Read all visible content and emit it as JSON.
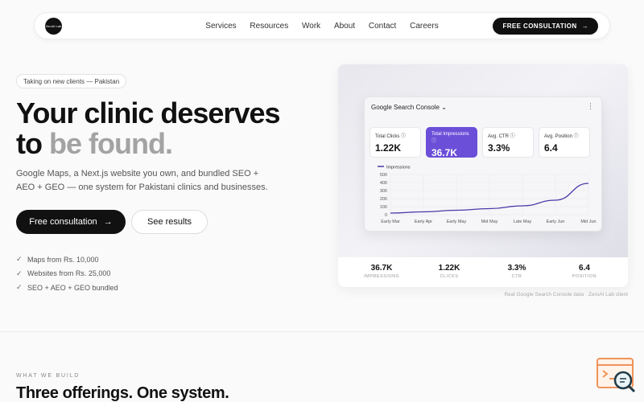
{
  "nav": {
    "logo_text": "ZeroAI Lab",
    "links": [
      "Services",
      "Resources",
      "Work",
      "About",
      "Contact",
      "Careers"
    ],
    "cta_label": "FREE CONSULTATION",
    "cta_icon": "arrow-right-icon"
  },
  "hero": {
    "pill": "Taking on new clients — Pakistan",
    "headline_line1": "Your clinic deserves",
    "headline_to": "to",
    "headline_muted": "be found.",
    "subtitle": "Google Maps, a Next.js website you own, and bundled SEO + AEO + GEO — one system for Pakistani clinics and businesses.",
    "primary_button": "Free consultation",
    "secondary_button": "See results",
    "checklist": [
      "Maps from Rs. 10,000",
      "Websites from Rs. 25,000",
      "SEO + AEO + GEO bundled"
    ]
  },
  "console": {
    "title": "Google Search Console",
    "metrics": [
      {
        "label": "Total Clicks",
        "value": "1.22K"
      },
      {
        "label": "Total Impressions",
        "value": "36.7K"
      },
      {
        "label": "Avg. CTR",
        "value": "3.3%"
      },
      {
        "label": "Avg. Position",
        "value": "6.4"
      }
    ],
    "active_metric_color": "#6b4fd8"
  },
  "chart_data": {
    "type": "line",
    "series": [
      {
        "name": "Impressions",
        "color": "#4a3aa8",
        "x": [
          "Early Mar",
          "Early Apr",
          "Early May",
          "Mid May",
          "Late May",
          "Early Jun",
          "Mid Jun"
        ],
        "values": [
          20,
          35,
          55,
          75,
          110,
          180,
          390
        ]
      }
    ],
    "x_ticks": [
      "Early Mar",
      "Early Apr",
      "Early May",
      "Mid May",
      "Late May",
      "Early Jun",
      "Mid Jun"
    ],
    "y_ticks": [
      0,
      100,
      200,
      300,
      400,
      500
    ],
    "ylim": [
      0,
      500
    ],
    "grid": true
  },
  "stats": [
    {
      "value": "36.7K",
      "label": "IMPRESSIONS"
    },
    {
      "value": "1.22K",
      "label": "CLICKS"
    },
    {
      "value": "3.3%",
      "label": "CTR"
    },
    {
      "value": "6.4",
      "label": "POSITION"
    }
  ],
  "caption": "Real Google Search Console data · ZeroAI Lab client",
  "section": {
    "eyebrow": "WHAT WE BUILD",
    "title": "Three offerings. One system."
  }
}
